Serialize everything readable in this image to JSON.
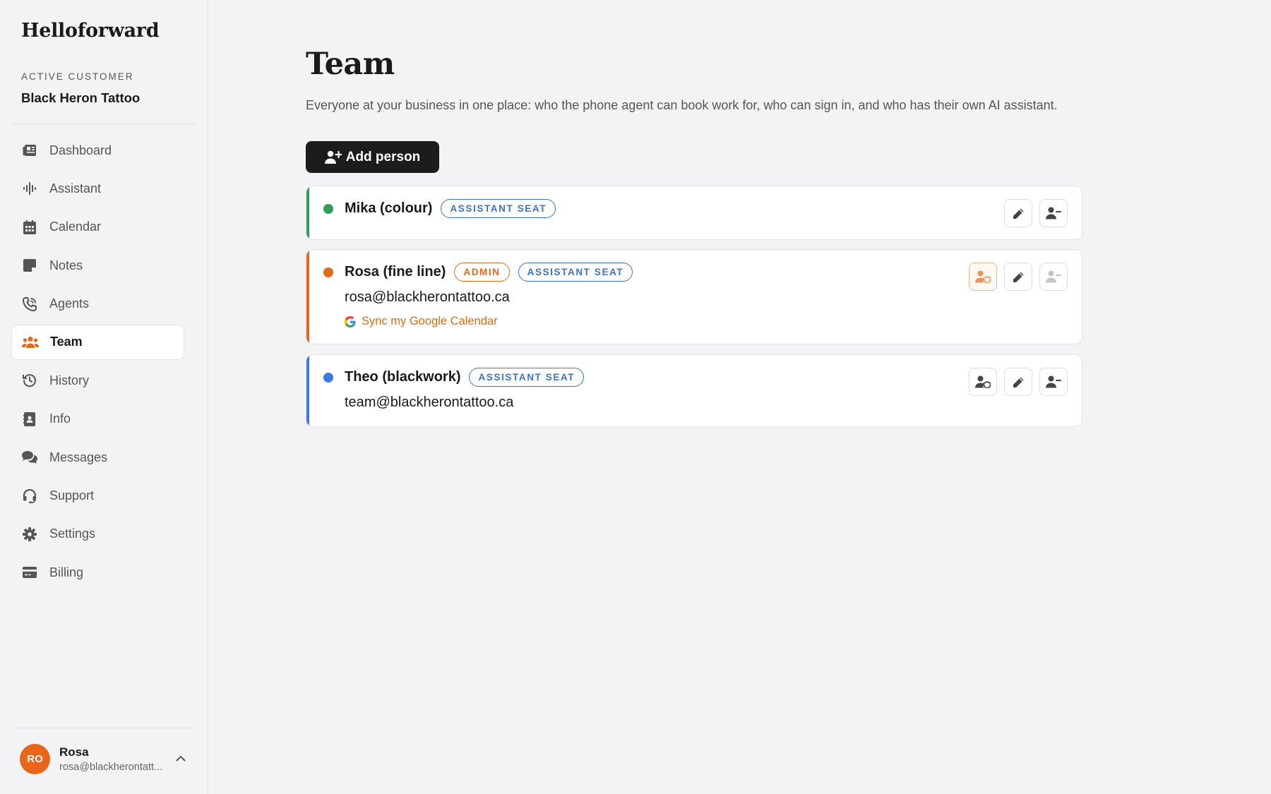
{
  "sidebar": {
    "brand": "Helloforward",
    "active_customer_label": "ACTIVE CUSTOMER",
    "active_customer_name": "Black Heron Tattoo",
    "items": [
      {
        "label": "Dashboard",
        "icon": "dashboard-icon"
      },
      {
        "label": "Assistant",
        "icon": "waveform-icon"
      },
      {
        "label": "Calendar",
        "icon": "calendar-icon"
      },
      {
        "label": "Notes",
        "icon": "note-icon"
      },
      {
        "label": "Agents",
        "icon": "phone-icon"
      },
      {
        "label": "Team",
        "icon": "users-icon",
        "active": true
      },
      {
        "label": "History",
        "icon": "history-icon"
      },
      {
        "label": "Info",
        "icon": "contact-card-icon"
      },
      {
        "label": "Messages",
        "icon": "chat-icon"
      },
      {
        "label": "Support",
        "icon": "headset-icon"
      },
      {
        "label": "Settings",
        "icon": "gear-icon"
      },
      {
        "label": "Billing",
        "icon": "credit-card-icon"
      }
    ],
    "user": {
      "initials": "RO",
      "name": "Rosa",
      "email": "rosa@blackherontatt..."
    }
  },
  "main": {
    "title": "Team",
    "description": "Everyone at your business in one place: who the phone agent can book work for, who can sign in, and who has their own AI assistant.",
    "add_button": "Add person",
    "members": [
      {
        "name": "Mika (colour)",
        "color": "#2e9e5b",
        "badges": [
          "ASSISTANT SEAT"
        ],
        "email": "",
        "sync": ""
      },
      {
        "name": "Rosa (fine line)",
        "color": "#e06a1b",
        "badges": [
          "ADMIN",
          "ASSISTANT SEAT"
        ],
        "email": "rosa@blackherontattoo.ca",
        "sync": "Sync my Google Calendar"
      },
      {
        "name": "Theo (blackwork)",
        "color": "#3b7ae0",
        "badges": [
          "ASSISTANT SEAT"
        ],
        "email": "team@blackherontattoo.ca",
        "sync": ""
      }
    ]
  },
  "colors": {
    "accent": "#e06a1b",
    "seat_badge": "#3a73c9",
    "button_dark": "#1c1c1e"
  }
}
